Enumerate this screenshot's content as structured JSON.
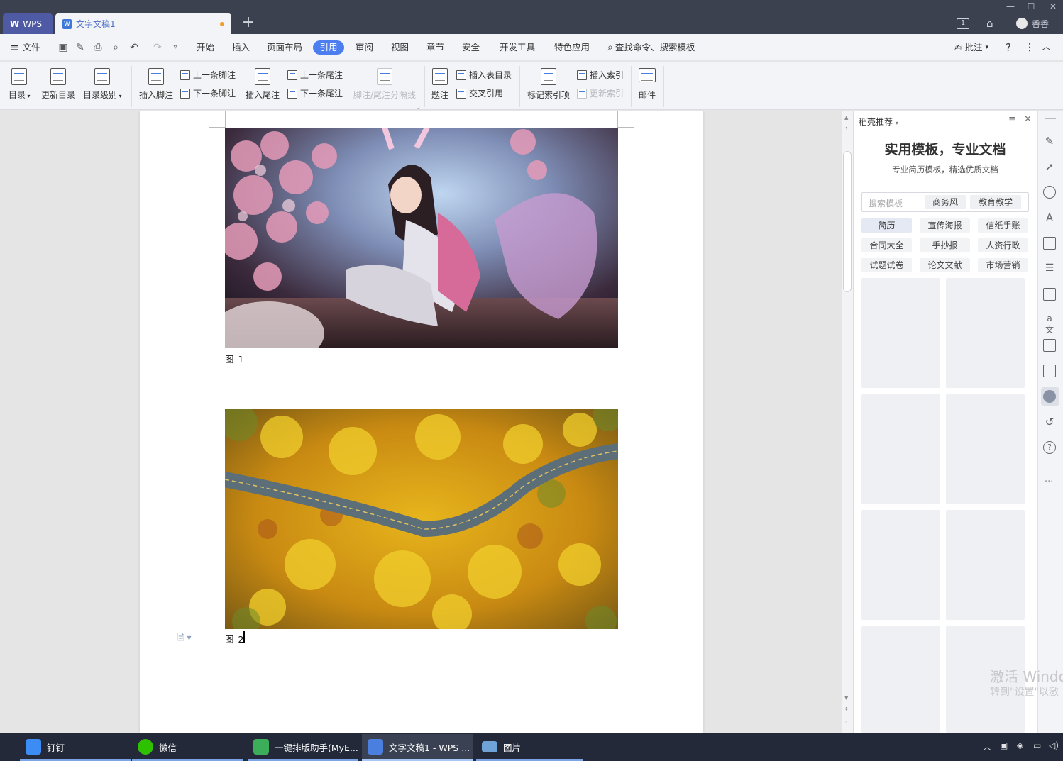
{
  "titlebar": {
    "app_tab": "WPS",
    "doc_tab": "文字文稿1",
    "new_tab": "+",
    "user": "香香",
    "badge": "1"
  },
  "menubar": {
    "file": "文件",
    "tabs": [
      "开始",
      "插入",
      "页面布局",
      "引用",
      "审阅",
      "视图",
      "章节",
      "安全",
      "开发工具",
      "特色应用"
    ],
    "active_tab": "引用",
    "search": "查找命令、搜索模板",
    "comment": "批注",
    "help": "?"
  },
  "ribbon": {
    "toc": "目录",
    "update_toc": "更新目录",
    "toc_level": "目录级别",
    "insert_footnote": "插入脚注",
    "prev_footnote": "上一条脚注",
    "next_footnote": "下一条脚注",
    "insert_endnote": "插入尾注",
    "prev_endnote": "上一条尾注",
    "next_endnote": "下一条尾注",
    "separator": "脚注/尾注分隔线",
    "caption": "题注",
    "insert_table_toc": "插入表目录",
    "cross_ref": "交叉引用",
    "mark_index": "标记索引项",
    "insert_index": "插入索引",
    "update_index": "更新索引",
    "mail": "邮件"
  },
  "document": {
    "caption1": "图 1",
    "caption2": "图 2"
  },
  "panel": {
    "header": "稻壳推荐",
    "title": "实用模板，专业文档",
    "subtitle": "专业简历模板，精选优质文档",
    "search_placeholder": "搜索模板",
    "chips": [
      "商务风",
      "教育教学"
    ],
    "categories": [
      "简历",
      "宣传海报",
      "信纸手账",
      "合同大全",
      "手抄报",
      "人资行政",
      "试题试卷",
      "论文文献",
      "市场营销"
    ],
    "selected_category": "简历"
  },
  "watermark": {
    "line1": "激活 Windo",
    "line2": "转到\"设置\"以激"
  },
  "taskbar": {
    "items": [
      "钉钉",
      "微信",
      "一键排版助手(MyE...",
      "文字文稿1 - WPS ...",
      "图片"
    ],
    "active": "文字文稿1 - WPS ..."
  },
  "colors": {
    "accent": "#4d7ef0",
    "titlebar": "#3c4150",
    "taskbar": "#232938"
  }
}
